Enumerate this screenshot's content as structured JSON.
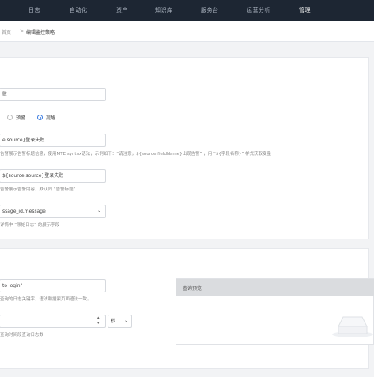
{
  "nav": {
    "items": [
      {
        "label": "日志"
      },
      {
        "label": "自动化"
      },
      {
        "label": "资产"
      },
      {
        "label": "知识库"
      },
      {
        "label": "服务台"
      },
      {
        "label": "运营分析"
      },
      {
        "label": "管理"
      }
    ],
    "active": "管理"
  },
  "breadcrumb": {
    "parent": "首页",
    "separator": ">",
    "current": "编辑监控策略"
  },
  "form": {
    "name_value": "败",
    "level_options": [
      "预警",
      "提醒"
    ],
    "level_selected": "提醒",
    "alert_title_value": "e.source}登录失败",
    "alert_title_hint": "告警展示告警标题信息，使用MTE syntax语法，示例如下：“请注意，${source.fieldName}出现告警” ，用 “${字段名称}” 样式获取变量",
    "alert_content_value": "${source.source}登录失败",
    "alert_content_hint": "告警展示告警内容，默认同 “告警标题”",
    "display_fields_value": "ssage_id,message",
    "display_fields_hint": "详情中 “原始日志” 的展示字段"
  },
  "query": {
    "keyword_value": "to login\"",
    "keyword_hint": "查询的日志关键字，语法和搜索页面语法一致。",
    "interval_unit": "秒",
    "interval_hint": "查询时间段查询日志数",
    "preview_title": "查询预览"
  }
}
